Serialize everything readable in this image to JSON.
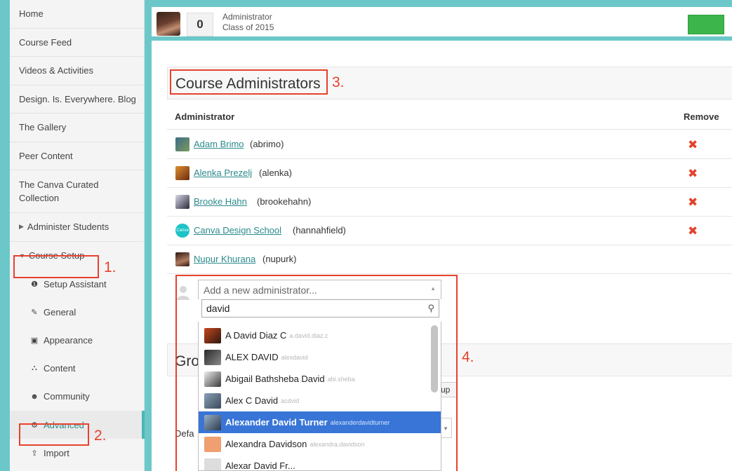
{
  "sidebar": {
    "items": [
      {
        "label": "Home"
      },
      {
        "label": "Course Feed"
      },
      {
        "label": "Videos & Activities"
      },
      {
        "label": "Design. Is. Everywhere. Blog"
      },
      {
        "label": "The Gallery"
      },
      {
        "label": "Peer Content"
      },
      {
        "label": "The Canva Curated Collection"
      },
      {
        "label": "Administer Students"
      },
      {
        "label": "Course Setup"
      }
    ],
    "setup_items": [
      {
        "label": "Setup Assistant",
        "icon": "info-circle-icon",
        "glyph": "❶"
      },
      {
        "label": "General",
        "icon": "edit-icon",
        "glyph": "✎"
      },
      {
        "label": "Appearance",
        "icon": "image-icon",
        "glyph": "▣"
      },
      {
        "label": "Content",
        "icon": "sitemap-icon",
        "glyph": "⛬"
      },
      {
        "label": "Community",
        "icon": "users-icon",
        "glyph": "☻"
      },
      {
        "label": "Advanced",
        "icon": "cogs-icon",
        "glyph": "⚙"
      },
      {
        "label": "Import",
        "icon": "upload-icon",
        "glyph": "⇪"
      }
    ],
    "active_item": "Advanced"
  },
  "header": {
    "score": "0",
    "role": "Administrator",
    "class": "Class of 2015"
  },
  "admins_section": {
    "title": "Course Administrators",
    "col_admin": "Administrator",
    "col_remove": "Remove",
    "remove_glyph": "✖",
    "rows": [
      {
        "name": "Adam Brimo",
        "handle": "(abrimo)",
        "removable": true,
        "color": "#5a7a4a"
      },
      {
        "name": "Alenka Prezelj",
        "handle": "(alenka)",
        "removable": true,
        "color": "#8a4a2a"
      },
      {
        "name": "Brooke Hahn",
        "handle": "(brookehahn)",
        "removable": true,
        "color": "#4a4a5a"
      },
      {
        "name": "Canva Design School",
        "handle": "(hannahfield)",
        "removable": true,
        "color": "#1cc3c6"
      },
      {
        "name": "Nupur Khurana",
        "handle": "(nupurk)",
        "removable": false,
        "color": "#5a3020"
      }
    ]
  },
  "add_admin": {
    "placeholder": "Add a new administrator...",
    "search_value": "david",
    "results": [
      {
        "name": "A David Diaz C",
        "user": "a.david.diaz.c",
        "color": "#c8461e"
      },
      {
        "name": "ALEX DAVID",
        "user": "alexdavid",
        "color": "#4a4a4a"
      },
      {
        "name": "Abigail Bathsheba David",
        "user": "abi.sheba",
        "color": "#7a7a7a"
      },
      {
        "name": "Alex C David",
        "user": "acdvid",
        "color": "#6a7a8a"
      },
      {
        "name": "Alexander David Turner",
        "user": "alexanderdavidturner",
        "color": "#5a6a7a",
        "highlighted": true
      },
      {
        "name": "Alexandra Davidson",
        "user": "alexandra.davidson",
        "color": "#f0a070"
      },
      {
        "name": "Alexar David Fr...",
        "user": "",
        "color": "#dddddd"
      }
    ]
  },
  "groups_section": {
    "title": "Gro",
    "button": "up",
    "default_label": "Defa"
  },
  "annotations": [
    {
      "label": "1."
    },
    {
      "label": "2."
    },
    {
      "label": "3."
    },
    {
      "label": "4."
    }
  ],
  "colors": {
    "teal": "#6cc7c9",
    "link": "#2b8a8c",
    "highlight": "#3875d7",
    "annotation": "#e8412d",
    "green": "#3cb54a"
  }
}
